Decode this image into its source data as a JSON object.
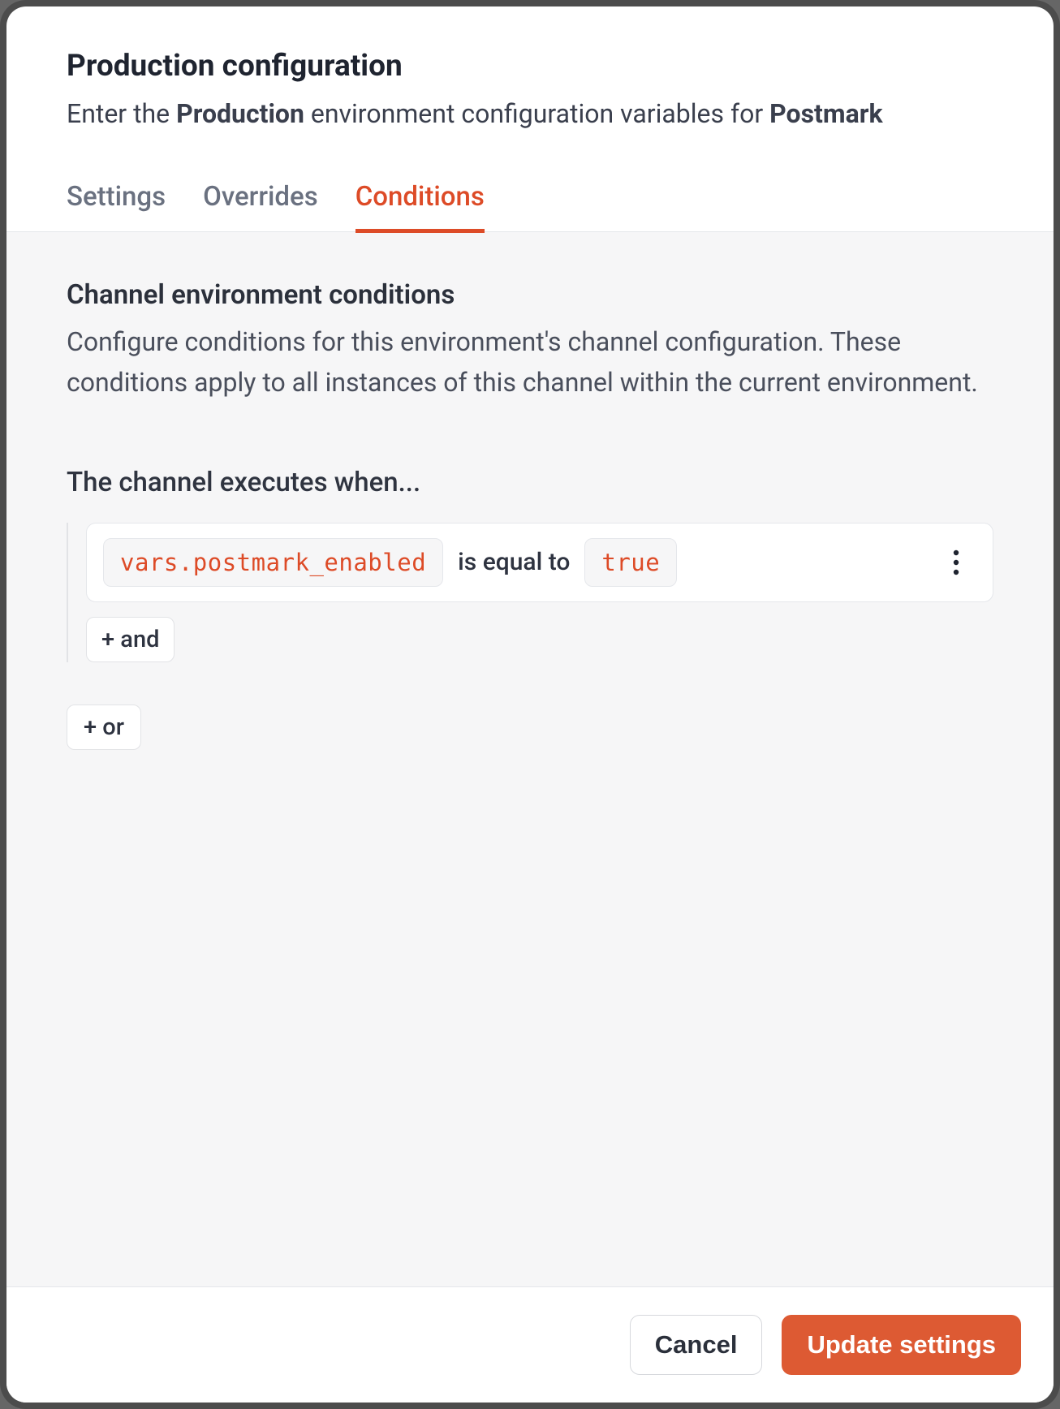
{
  "header": {
    "title": "Production configuration",
    "subtitle_prefix": "Enter the ",
    "subtitle_env": "Production",
    "subtitle_mid": " environment configuration variables for ",
    "subtitle_provider": "Postmark"
  },
  "tabs": {
    "settings": "Settings",
    "overrides": "Overrides",
    "conditions": "Conditions"
  },
  "section": {
    "title": "Channel environment conditions",
    "description": "Configure conditions for this environment's channel configuration. These conditions apply to all instances of this channel within the current environment."
  },
  "executes_label": "The channel executes when...",
  "condition": {
    "variable": "vars.postmark_enabled",
    "operator": "is equal to",
    "value": "true"
  },
  "buttons": {
    "add_and": "+ and",
    "add_or": "+ or",
    "cancel": "Cancel",
    "update": "Update settings"
  }
}
